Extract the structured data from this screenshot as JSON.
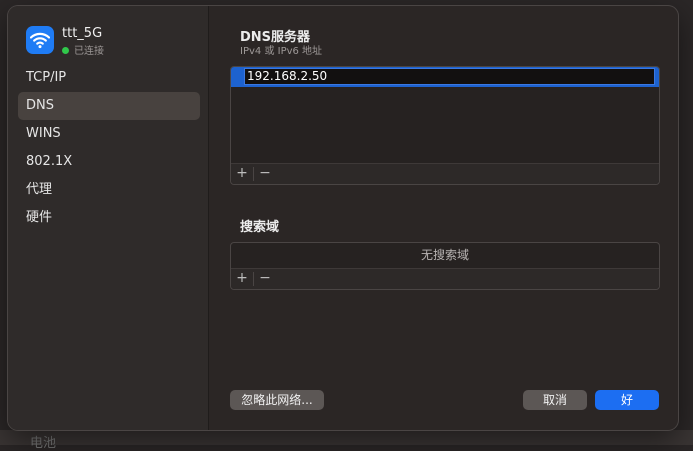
{
  "network": {
    "name": "ttt_5G",
    "status": "已连接",
    "status_color": "#30c84b",
    "icon": "wifi-icon"
  },
  "sidebar": {
    "items": [
      {
        "label": "TCP/IP",
        "selected": false
      },
      {
        "label": "DNS",
        "selected": true
      },
      {
        "label": "WINS",
        "selected": false
      },
      {
        "label": "802.1X",
        "selected": false
      },
      {
        "label": "代理",
        "selected": false
      },
      {
        "label": "硬件",
        "selected": false
      }
    ]
  },
  "dns": {
    "title": "DNS服务器",
    "subtitle": "IPv4 或 IPv6 地址",
    "servers": [
      "192.168.2.50"
    ],
    "add_label": "+",
    "remove_label": "−"
  },
  "search_domains": {
    "title": "搜索域",
    "empty_text": "无搜索域",
    "add_label": "+",
    "remove_label": "−"
  },
  "buttons": {
    "forget": "忽略此网络...",
    "cancel": "取消",
    "ok": "好"
  },
  "colors": {
    "accent": "#1c6ef2",
    "selection": "#1d62cf"
  },
  "backdrop": {
    "partial_text": "电池"
  }
}
